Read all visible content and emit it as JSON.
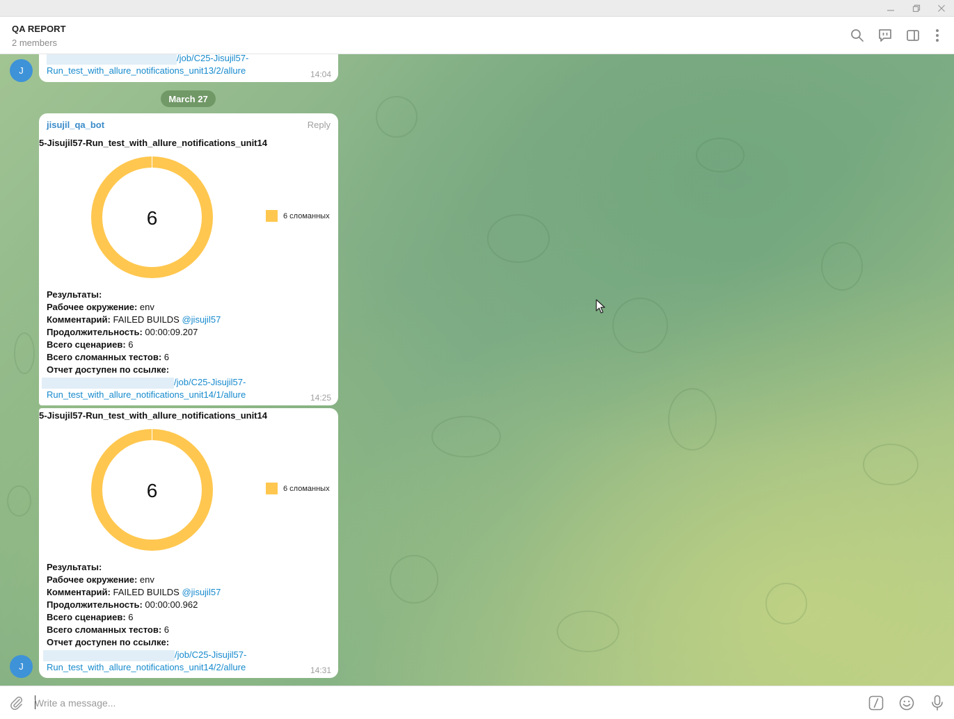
{
  "window": {
    "minimize_icon": "minimize-icon",
    "maximize_icon": "restore-icon",
    "close_icon": "close-icon"
  },
  "header": {
    "title": "QA REPORT",
    "subtitle": "2 members",
    "icons": [
      "search-icon",
      "video-chat-icon",
      "sidebar-toggle-icon",
      "more-vertical-icon"
    ]
  },
  "chat": {
    "prev_message": {
      "avatar_initial": "J",
      "url_part1": "/job/C25-Jisujil57-",
      "url_part2": "Run_test_with_allure_notifications_unit13/2/allure",
      "time": "14:04"
    },
    "date_separator": "March 27",
    "messages": [
      {
        "sender": "jisujil_qa_bot",
        "reply_label": "Reply",
        "report_title": "5-Jisujil57-Run_test_with_allure_notifications_unit14",
        "donut_center": "6",
        "legend_label": "6 сломанных",
        "results_label": "Результаты:",
        "env_label": "Рабочее окружение:",
        "env_value": " env",
        "comment_label": "Комментарий:",
        "comment_value": " FAILED BUILDS ",
        "comment_mention": "@jisujil57",
        "duration_label": "Продолжительность:",
        "duration_value": " 00:00:09.207",
        "scenarios_label": "Всего сценариев:",
        "scenarios_value": " 6",
        "broken_label": "Всего сломанных тестов:",
        "broken_value": " 6",
        "link_label": "Отчет доступен по ссылке:",
        "url_part1": "/job/C25-Jisujil57-",
        "url_part2": "Run_test_with_allure_notifications_unit14/1/allure",
        "time": "14:25"
      },
      {
        "report_title": "5-Jisujil57-Run_test_with_allure_notifications_unit14",
        "donut_center": "6",
        "legend_label": "6 сломанных",
        "results_label": "Результаты:",
        "env_label": "Рабочее окружение:",
        "env_value": " env",
        "comment_label": "Комментарий:",
        "comment_value": " FAILED BUILDS ",
        "comment_mention": "@jisujil57",
        "duration_label": "Продолжительность:",
        "duration_value": " 00:00:00.962",
        "scenarios_label": "Всего сценариев:",
        "scenarios_value": " 6",
        "broken_label": "Всего сломанных тестов:",
        "broken_value": " 6",
        "link_label": "Отчет доступен по ссылке:",
        "url_part1": "/job/C25-Jisujil57-",
        "url_part2": "Run_test_with_allure_notifications_unit14/2/allure",
        "avatar_initial": "J",
        "time": "14:31"
      }
    ]
  },
  "input": {
    "placeholder": "Write a message...",
    "icons": [
      "attach-icon",
      "bot-commands-icon",
      "emoji-icon",
      "microphone-icon"
    ]
  },
  "colors": {
    "accent": "#168acd",
    "donut_broken": "#ffc74f",
    "avatar": "#3e92d8"
  }
}
